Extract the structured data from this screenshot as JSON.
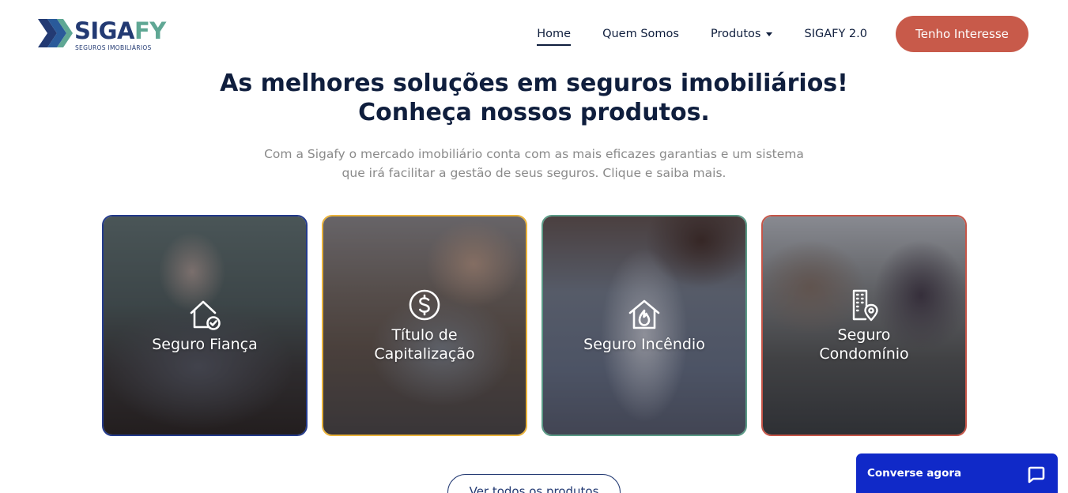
{
  "header": {
    "logo": {
      "word_a": "SIGA",
      "word_b": "FY",
      "tagline": "SEGUROS IMOBILIÁRIOS",
      "icon": "chevron-arrows-logo-icon"
    },
    "nav": [
      {
        "label": "Home",
        "active": true
      },
      {
        "label": "Quem Somos",
        "active": false
      },
      {
        "label": "Produtos",
        "active": false,
        "has_dropdown": true,
        "dropdown_icon": "caret-down-icon"
      },
      {
        "label": "SIGAFY 2.0",
        "active": false
      }
    ],
    "cta_label": "Tenho Interesse"
  },
  "hero": {
    "title_line1": "As melhores soluções em seguros imobiliários!",
    "title_line2": "Conheça nossos produtos.",
    "subtitle_line1": "Com a Sigafy o mercado imobiliário conta com as mais eficazes garantias e um sistema",
    "subtitle_line2": "que irá facilitar a gestão de seus seguros. Clique e saiba mais."
  },
  "products": [
    {
      "label_line1": "Seguro Fiança",
      "label_line2": "",
      "icon": "house-check-icon",
      "border_color": "#233a8a"
    },
    {
      "label_line1": "Título de",
      "label_line2": "Capitalização",
      "icon": "dollar-circle-icon",
      "border_color": "#e9b23a"
    },
    {
      "label_line1": "Seguro Incêndio",
      "label_line2": "",
      "icon": "house-fire-icon",
      "border_color": "#5a9a86"
    },
    {
      "label_line1": "Seguro",
      "label_line2": "Condomínio",
      "icon": "building-pin-icon",
      "border_color": "#c55548"
    }
  ],
  "all_products_label": "Ver todos os produtos",
  "chat": {
    "label": "Converse agora",
    "icon": "chat-bubble-icon"
  },
  "colors": {
    "brand_navy": "#233a73",
    "brand_green": "#5fa794",
    "cta": "#c85a4a",
    "chat": "#1029c8"
  }
}
